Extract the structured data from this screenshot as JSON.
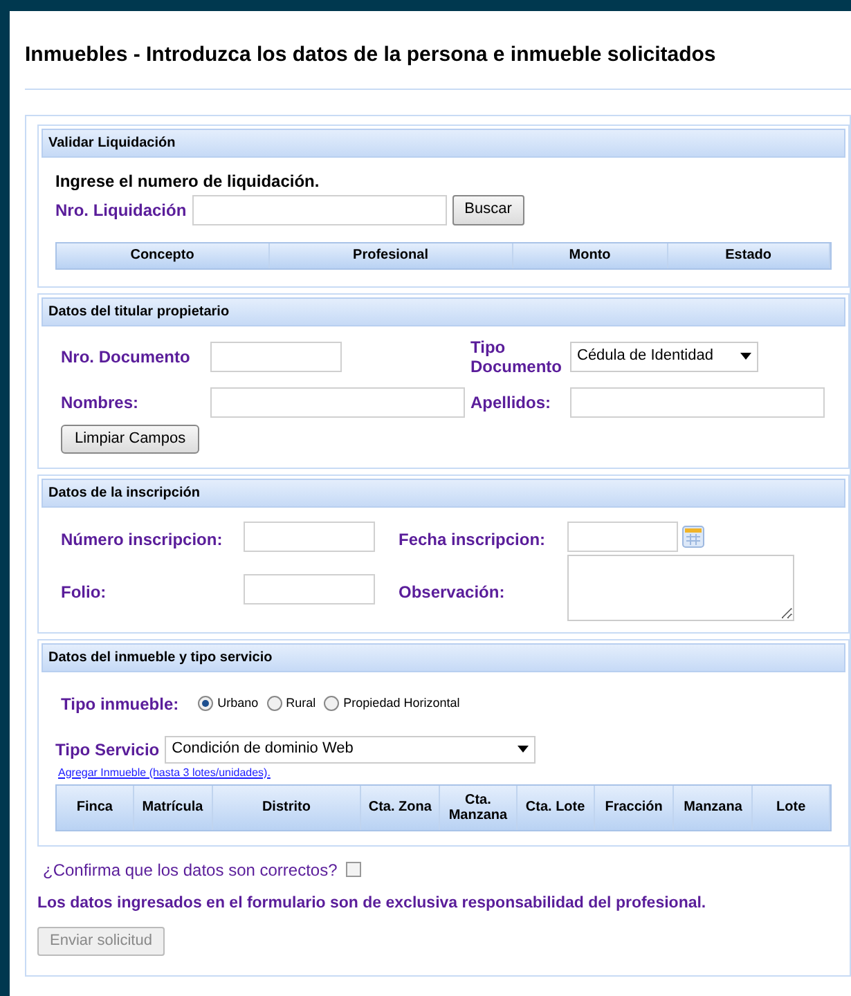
{
  "title": "Inmuebles - Introduzca los datos de la persona e inmueble solicitados",
  "validar": {
    "title": "Validar Liquidación",
    "prompt": "Ingrese el numero de liquidación.",
    "label": "Nro. Liquidación",
    "button": "Buscar",
    "columns": [
      "Concepto",
      "Profesional",
      "Monto",
      "Estado"
    ]
  },
  "titular": {
    "title": "Datos del titular propietario",
    "doc_label": "Nro. Documento",
    "tipo_label": "Tipo Documento",
    "tipo_value": "Cédula de Identidad",
    "nombres_label": "Nombres:",
    "apellidos_label": "Apellidos:",
    "button": "Limpiar Campos"
  },
  "inscripcion": {
    "title": "Datos de la inscripción",
    "numero_label": "Número inscripcion:",
    "fecha_label": "Fecha inscripcion:",
    "folio_label": "Folio:",
    "obs_label": "Observación:"
  },
  "inmueble": {
    "title": "Datos del inmueble y tipo servicio",
    "tipo_label": "Tipo inmueble:",
    "options": [
      {
        "label": "Urbano",
        "selected": true
      },
      {
        "label": "Rural",
        "selected": false
      },
      {
        "label": "Propiedad Horizontal",
        "selected": false
      }
    ],
    "servicio_label": "Tipo Servicio",
    "servicio_value": "Condición de dominio Web",
    "link": "Agregar Inmueble (hasta 3 lotes/unidades).",
    "columns": [
      "Finca",
      "Matrícula",
      "Distrito",
      "Cta. Zona",
      "Cta. Manzana",
      "Cta. Lote",
      "Fracción",
      "Manzana",
      "Lote"
    ]
  },
  "confirm": {
    "label": "¿Confirma que los datos son correctos?",
    "checked": false
  },
  "disclaimer": "Los datos ingresados en el formulario son de exclusiva responsabilidad del profesional.",
  "submit": {
    "label": "Enviar solicitud",
    "disabled": true
  }
}
